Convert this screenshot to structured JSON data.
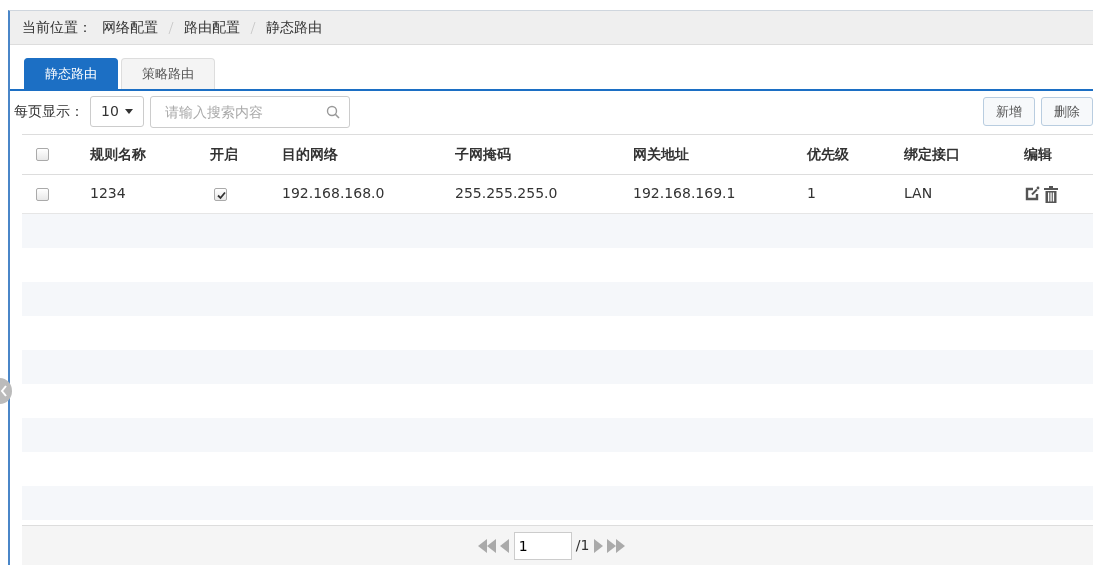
{
  "breadcrumb": {
    "label": "当前位置：",
    "items": [
      "网络配置",
      "路由配置",
      "静态路由"
    ]
  },
  "tabs": [
    {
      "label": "静态路由",
      "selected": true
    },
    {
      "label": "策略路由",
      "selected": false
    }
  ],
  "toolbar": {
    "page_size_label": "每页显示：",
    "page_size": "10",
    "search": {
      "placeholder": "请输入搜索内容"
    },
    "buttons": [
      "新增",
      "删除"
    ]
  },
  "table": {
    "select_all": {
      "checked": false
    },
    "columns": [
      "规则名称",
      "开启",
      "目的网络",
      "子网掩码",
      "网关地址",
      "优先级",
      "绑定接口",
      "编辑"
    ],
    "rows": [
      {
        "checked": false,
        "name": "1234",
        "enabled": true,
        "destination": "192.168.168.0",
        "netmask": "255.255.255.0",
        "gateway": "192.168.169.1",
        "priority": "1",
        "interface": "LAN"
      }
    ]
  },
  "pagination": {
    "page": "1",
    "total": "/1"
  }
}
